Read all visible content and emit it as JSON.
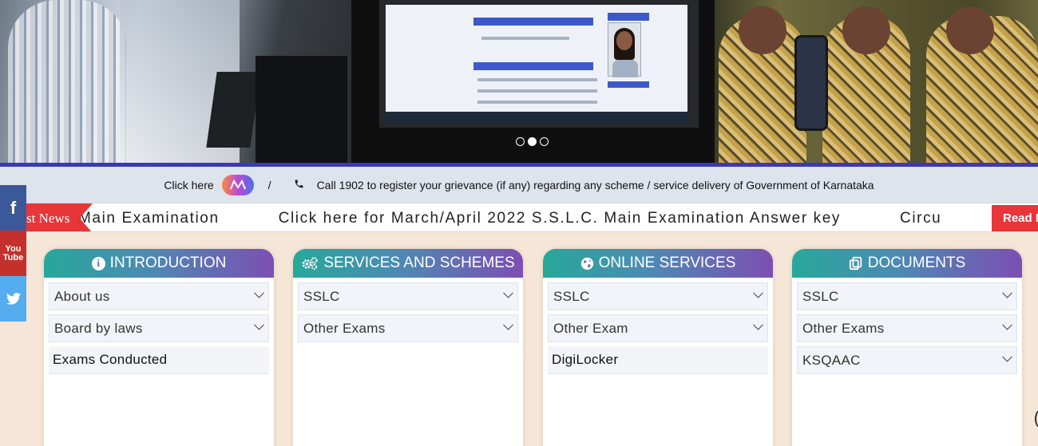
{
  "hero": {
    "slides": 3,
    "active_slide": 2
  },
  "info_bar": {
    "click_here": "Click here",
    "separator": "/",
    "grievance_text": "Call 1902 to register your grievance (if any) regarding any scheme / service delivery of Government of Karnataka"
  },
  "ticker": {
    "tag": "st News",
    "items": [
      "Main Examination",
      "Click here for March/April 2022 S.S.L.C. Main Examination Answer key",
      "Circu"
    ],
    "read_more": "Read M"
  },
  "social": [
    {
      "name": "facebook",
      "glyph": "f"
    },
    {
      "name": "youtube",
      "glyph_top": "You",
      "glyph_bottom": "Tube"
    },
    {
      "name": "twitter"
    }
  ],
  "colors": {
    "page_bg": "#f6e6d7",
    "accent_red": "#e8353a",
    "header_gradient_start": "#27a89a",
    "header_gradient_end": "#7c4fb3",
    "divider_blue": "#3a3ab5",
    "facebook": "#3b5998",
    "youtube": "#c4302b",
    "twitter": "#55acee"
  },
  "cards": [
    {
      "title": "INTRODUCTION",
      "icon": "info-circle-icon",
      "items": [
        {
          "label": "About us",
          "expandable": true
        },
        {
          "label": "Board by laws",
          "expandable": true
        },
        {
          "label": "Exams Conducted",
          "expandable": false
        }
      ]
    },
    {
      "title": "SERVICES AND SCHEMES",
      "icon": "cogs-icon",
      "items": [
        {
          "label": "SSLC",
          "expandable": true
        },
        {
          "label": "Other Exams",
          "expandable": true
        }
      ]
    },
    {
      "title": "ONLINE SERVICES",
      "icon": "globe-icon",
      "items": [
        {
          "label": "SSLC",
          "expandable": true
        },
        {
          "label": "Other Exam",
          "expandable": true
        },
        {
          "label": "DigiLocker",
          "expandable": false
        }
      ]
    },
    {
      "title": "DOCUMENTS",
      "icon": "copy-files-icon",
      "items": [
        {
          "label": "SSLC",
          "expandable": true
        },
        {
          "label": "Other Exams",
          "expandable": true
        },
        {
          "label": "KSQAAC",
          "expandable": true
        }
      ]
    }
  ]
}
